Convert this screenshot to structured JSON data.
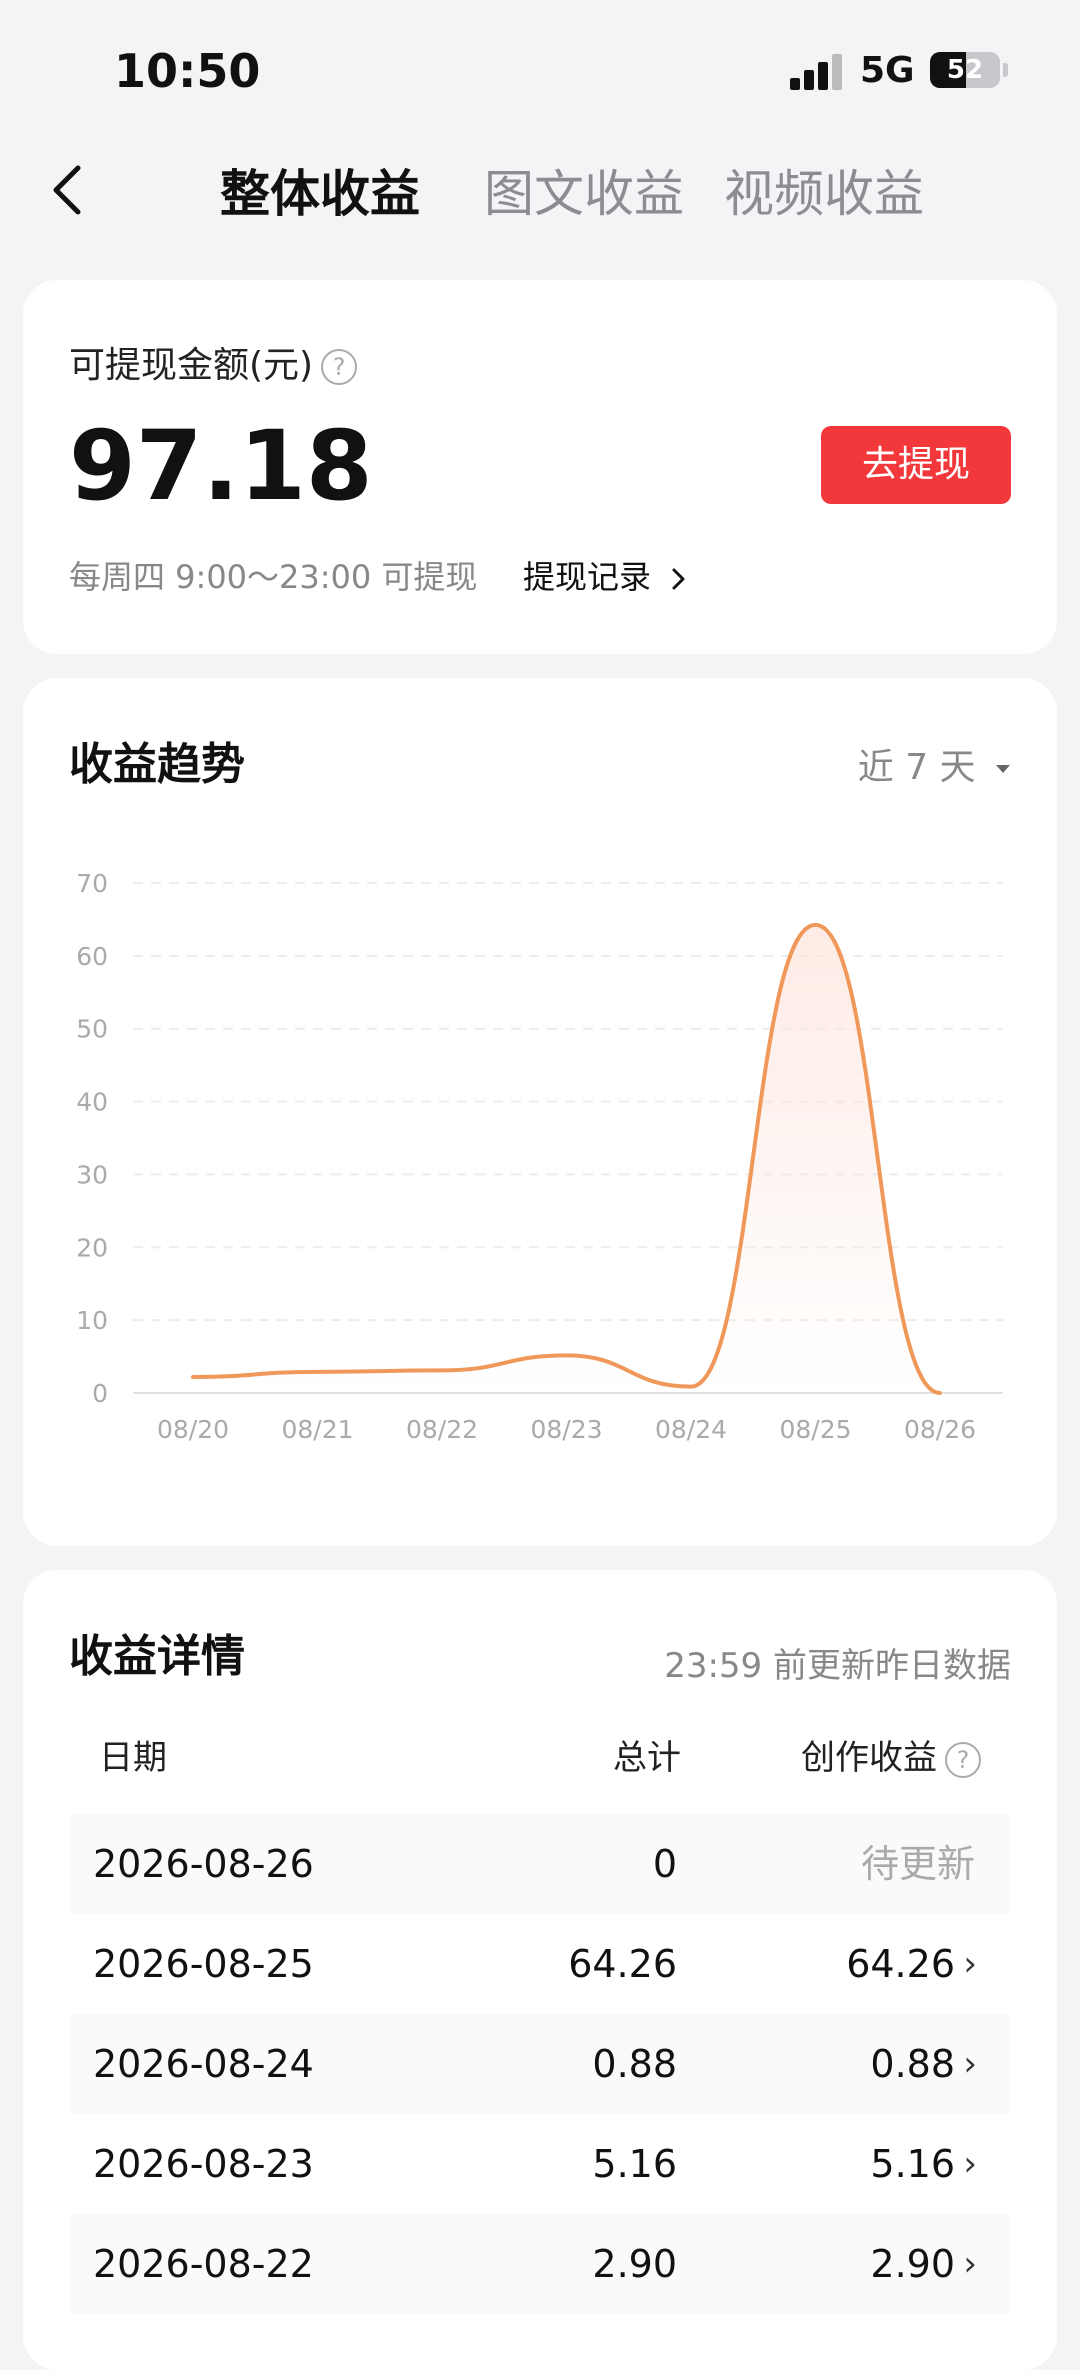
{
  "status_bar": {
    "time": "10:50",
    "network": "5G",
    "battery": "52",
    "battery_level": 0.52
  },
  "nav": {
    "back_icon": "chevron-left-icon",
    "tabs": [
      {
        "label": "整体收益",
        "active": true
      },
      {
        "label": "图文收益",
        "active": false
      },
      {
        "label": "视频收益",
        "active": false
      }
    ]
  },
  "balance": {
    "label": "可提现金额(元)",
    "help_icon": "question-circle-icon",
    "amount": "97.18",
    "withdraw_button": "去提现",
    "schedule": "每周四 9:00～23:00 可提现",
    "record_link": "提现记录",
    "record_icon": "chevron-right-icon"
  },
  "trend": {
    "title": "收益趋势",
    "range": "近 7 天",
    "range_icon": "caret-down-icon"
  },
  "chart_data": {
    "type": "area",
    "title": "",
    "xlabel": "",
    "ylabel": "",
    "categories": [
      "08/20",
      "08/21",
      "08/22",
      "08/23",
      "08/24",
      "08/25",
      "08/26"
    ],
    "values": [
      2.2,
      2.9,
      3.1,
      5.16,
      0.88,
      64.26,
      0
    ],
    "ylim": [
      0,
      70
    ],
    "yticks": [
      "0",
      "10",
      "20",
      "30",
      "40",
      "50",
      "60",
      "70"
    ],
    "grid": true,
    "line_color": "#f0985a",
    "fill_color": "#fde4dc"
  },
  "details": {
    "title": "收益详情",
    "update_note": "23:59 前更新昨日数据",
    "columns": {
      "date": "日期",
      "total": "总计",
      "creation": "创作收益"
    },
    "rows": [
      {
        "date": "2026-08-26",
        "total": "0",
        "creation": "待更新",
        "pending": true
      },
      {
        "date": "2026-08-25",
        "total": "64.26",
        "creation": "64.26",
        "pending": false
      },
      {
        "date": "2026-08-24",
        "total": "0.88",
        "creation": "0.88",
        "pending": false
      },
      {
        "date": "2026-08-23",
        "total": "5.16",
        "creation": "5.16",
        "pending": false
      },
      {
        "date": "2026-08-22",
        "total": "2.90",
        "creation": "2.90",
        "pending": false
      }
    ]
  },
  "colors": {
    "accent": "#f2383b",
    "background": "#f4f4f6"
  }
}
